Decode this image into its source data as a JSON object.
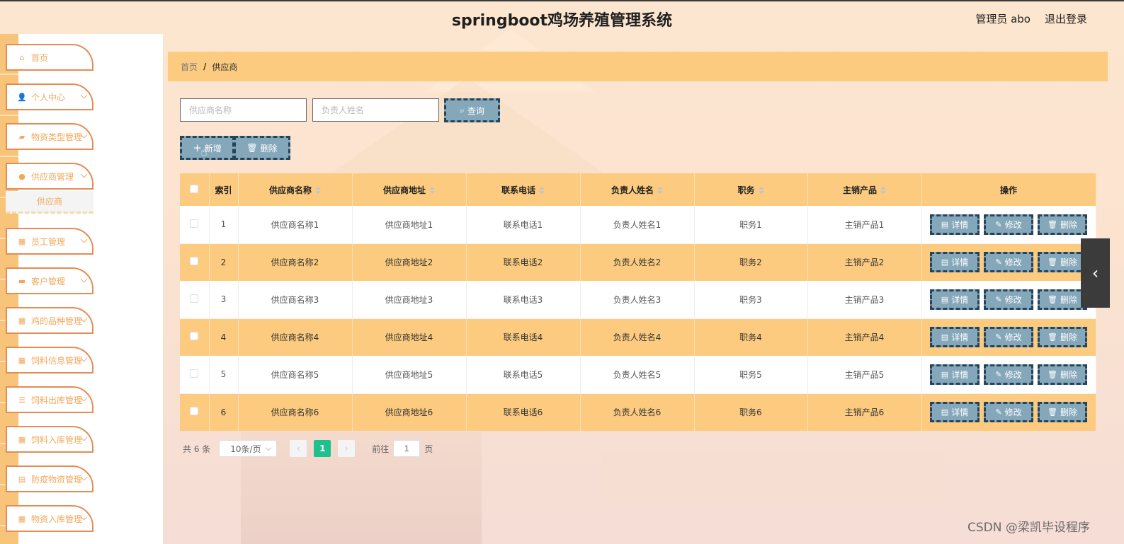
{
  "header": {
    "title": "springboot鸡场养殖管理系统",
    "user": "管理员 abo",
    "logout": "退出登录"
  },
  "sidebar": {
    "items": [
      {
        "label": "首页",
        "icon": "home-icon",
        "glyph": "⌂"
      },
      {
        "label": "个人中心",
        "icon": "user-icon",
        "glyph": "👤"
      },
      {
        "label": "物资类型管理",
        "icon": "box-icon",
        "glyph": "▰"
      },
      {
        "label": "供应商管理",
        "icon": "bulb-icon",
        "glyph": "●"
      },
      {
        "label": "员工管理",
        "icon": "grid-icon",
        "glyph": "▦"
      },
      {
        "label": "客户管理",
        "icon": "briefcase-icon",
        "glyph": "▬"
      },
      {
        "label": "鸡的品种管理",
        "icon": "grid-icon",
        "glyph": "▦"
      },
      {
        "label": "饲料信息管理",
        "icon": "grid-icon",
        "glyph": "▦"
      },
      {
        "label": "饲料出库管理",
        "icon": "sliders-icon",
        "glyph": "☰"
      },
      {
        "label": "饲料入库管理",
        "icon": "grid-icon",
        "glyph": "▦"
      },
      {
        "label": "防疫物资管理",
        "icon": "list-icon",
        "glyph": "▤"
      },
      {
        "label": "物资入库管理",
        "icon": "grid-icon",
        "glyph": "▦"
      }
    ],
    "submenu": "供应商"
  },
  "breadcrumb": {
    "home": "首页",
    "sep": "/",
    "current": "供应商"
  },
  "search": {
    "name_placeholder": "供应商名称",
    "person_placeholder": "负责人姓名",
    "query_label": "查询"
  },
  "toolbar": {
    "add_label": "新增",
    "delete_label": "删除"
  },
  "table": {
    "headers": [
      "索引",
      "供应商名称",
      "供应商地址",
      "联系电话",
      "负责人姓名",
      "职务",
      "主销产品",
      "操作"
    ],
    "rows": [
      {
        "index": "1",
        "name": "供应商名称1",
        "address": "供应商地址1",
        "phone": "联系电话1",
        "person": "负责人姓名1",
        "title": "职务1",
        "product": "主销产品1"
      },
      {
        "index": "2",
        "name": "供应商名称2",
        "address": "供应商地址2",
        "phone": "联系电话2",
        "person": "负责人姓名2",
        "title": "职务2",
        "product": "主销产品2"
      },
      {
        "index": "3",
        "name": "供应商名称3",
        "address": "供应商地址3",
        "phone": "联系电话3",
        "person": "负责人姓名3",
        "title": "职务3",
        "product": "主销产品3"
      },
      {
        "index": "4",
        "name": "供应商名称4",
        "address": "供应商地址4",
        "phone": "联系电话4",
        "person": "负责人姓名4",
        "title": "职务4",
        "product": "主销产品4"
      },
      {
        "index": "5",
        "name": "供应商名称5",
        "address": "供应商地址5",
        "phone": "联系电话5",
        "person": "负责人姓名5",
        "title": "职务5",
        "product": "主销产品5"
      },
      {
        "index": "6",
        "name": "供应商名称6",
        "address": "供应商地址6",
        "phone": "联系电话6",
        "person": "负责人姓名6",
        "title": "职务6",
        "product": "主销产品6"
      }
    ],
    "ops": {
      "detail": "详情",
      "edit": "修改",
      "delete": "删除"
    }
  },
  "pagination": {
    "total": "共 6 条",
    "page_size": "10条/页",
    "current_page": "1",
    "goto_prefix": "前往",
    "goto_value": "1",
    "goto_suffix": "页"
  },
  "watermark": "CSDN @梁凯毕设程序",
  "colors": {
    "accent": "#fccb7f",
    "button": "#85a7ba",
    "active_page": "#1ec08c"
  }
}
